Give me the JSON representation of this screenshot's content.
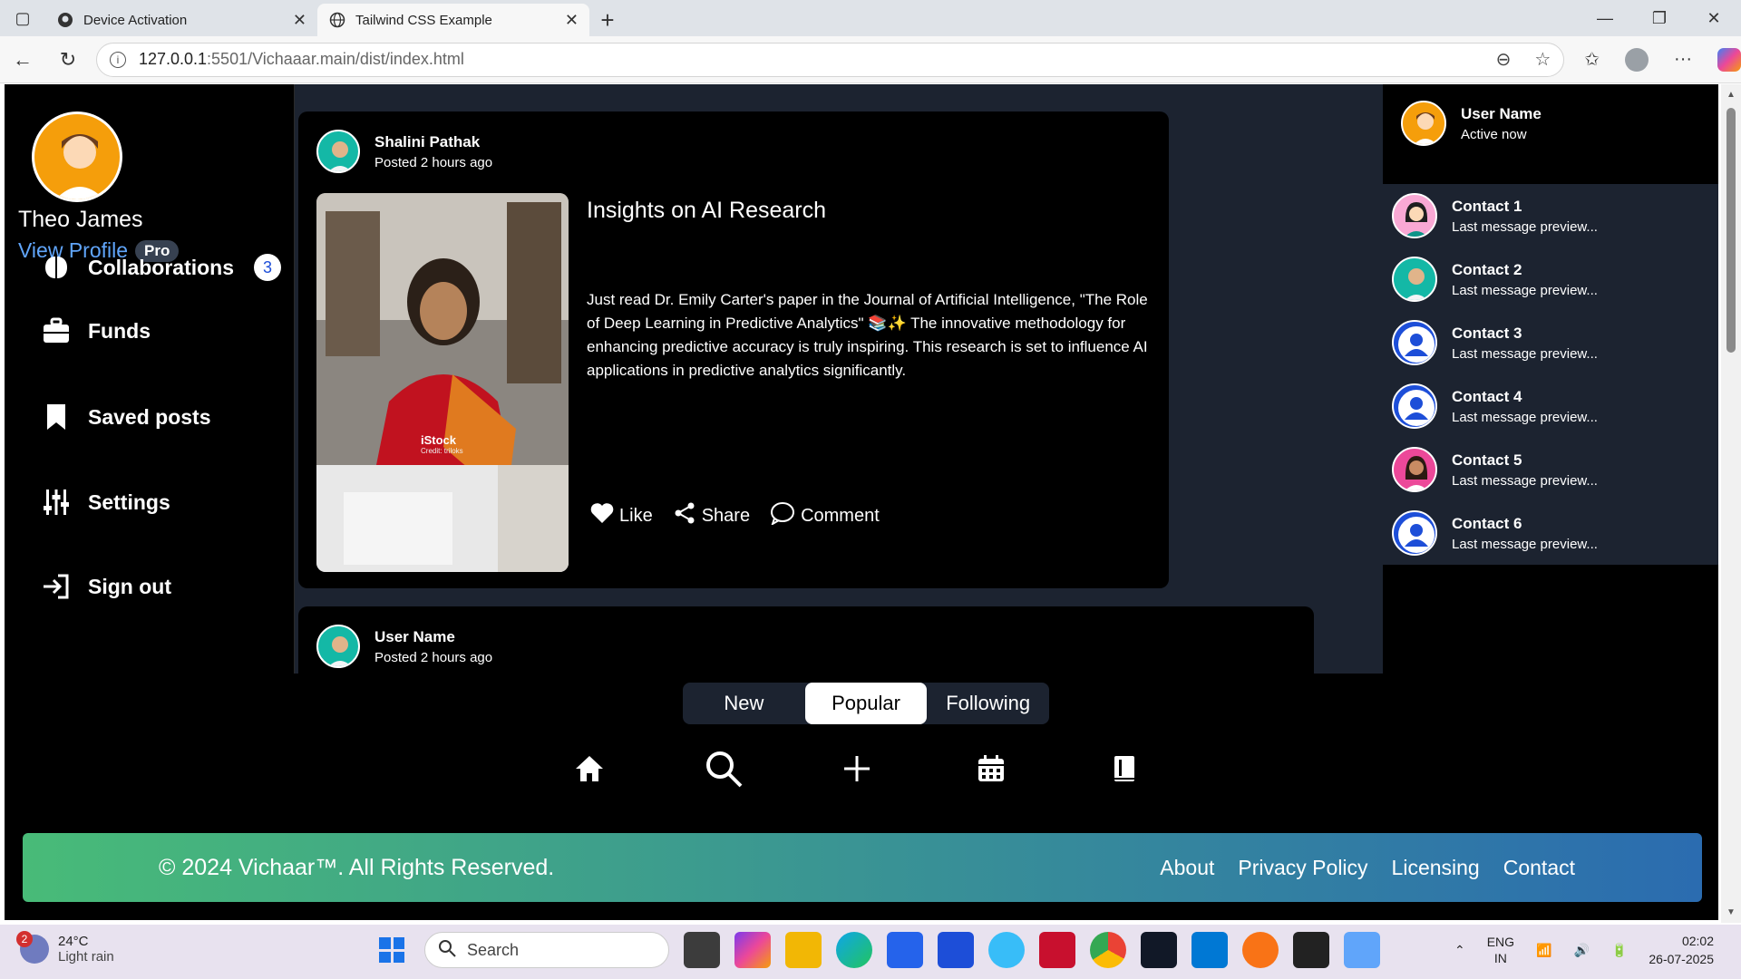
{
  "browser": {
    "tabs": [
      {
        "title": "Device Activation",
        "icon": "github-icon",
        "active": false
      },
      {
        "title": "Tailwind CSS Example",
        "icon": "globe-icon",
        "active": true
      }
    ],
    "url_host": "127.0.0.1",
    "url_rest": ":5501/Vichaaar.main/dist/index.html"
  },
  "sidebar": {
    "user_name": "Theo James",
    "view_profile": "View Profile",
    "pro_badge": "Pro",
    "items": [
      {
        "label": "Collaborations",
        "icon": "brain-icon",
        "badge": "3"
      },
      {
        "label": "Funds",
        "icon": "briefcase-icon"
      },
      {
        "label": "Saved posts",
        "icon": "bookmark-icon"
      },
      {
        "label": "Settings",
        "icon": "sliders-icon"
      },
      {
        "label": "Sign out",
        "icon": "sign-out-icon"
      }
    ]
  },
  "feed": {
    "posts": [
      {
        "author": "Shalini Pathak",
        "time": "Posted 2 hours ago",
        "title": "Insights on AI Research",
        "body": "Just read Dr. Emily Carter's paper in the Journal of Artificial Intelligence, \"The Role of Deep Learning in Predictive Analytics\" 📚✨ The innovative methodology for enhancing predictive accuracy is truly inspiring. This research is set to influence AI applications in predictive analytics significantly.",
        "image_watermark": "iStock",
        "image_credit": "Credit: triloks",
        "actions": {
          "like": "Like",
          "share": "Share",
          "comment": "Comment"
        }
      },
      {
        "author": "User Name",
        "time": "Posted 2 hours ago"
      }
    ]
  },
  "rightpanel": {
    "user_name": "User Name",
    "status": "Active now",
    "contacts": [
      {
        "name": "Contact 1",
        "preview": "Last message preview...",
        "avatar_color": "#f9a8d4"
      },
      {
        "name": "Contact 2",
        "preview": "Last message preview...",
        "avatar_color": "#14b8a6"
      },
      {
        "name": "Contact 3",
        "preview": "Last message preview...",
        "avatar_color": "#1d4ed8"
      },
      {
        "name": "Contact 4",
        "preview": "Last message preview...",
        "avatar_color": "#1d4ed8"
      },
      {
        "name": "Contact 5",
        "preview": "Last message preview...",
        "avatar_color": "#ec4899"
      },
      {
        "name": "Contact 6",
        "preview": "Last message preview...",
        "avatar_color": "#1d4ed8"
      }
    ]
  },
  "filter_tabs": [
    {
      "label": "New",
      "active": false
    },
    {
      "label": "Popular",
      "active": true
    },
    {
      "label": "Following",
      "active": false
    }
  ],
  "bottom_nav": [
    "home-icon",
    "search-icon",
    "plus-icon",
    "calendar-icon",
    "book-icon"
  ],
  "footer": {
    "copyright": "© 2024 Vichaar™. All Rights Reserved.",
    "links": [
      "About",
      "Privacy Policy",
      "Licensing",
      "Contact"
    ]
  },
  "taskbar": {
    "notification_count": "2",
    "temperature": "24°C",
    "condition": "Light rain",
    "search_placeholder": "Search",
    "lang_top": "ENG",
    "lang_bottom": "IN",
    "time": "02:02",
    "date": "26-07-2025"
  },
  "colors": {
    "feed_bg": "#1c2330",
    "accent_link": "#60a5fa",
    "footer_gradient_start": "#48bb78",
    "footer_gradient_end": "#2b6cb0"
  }
}
